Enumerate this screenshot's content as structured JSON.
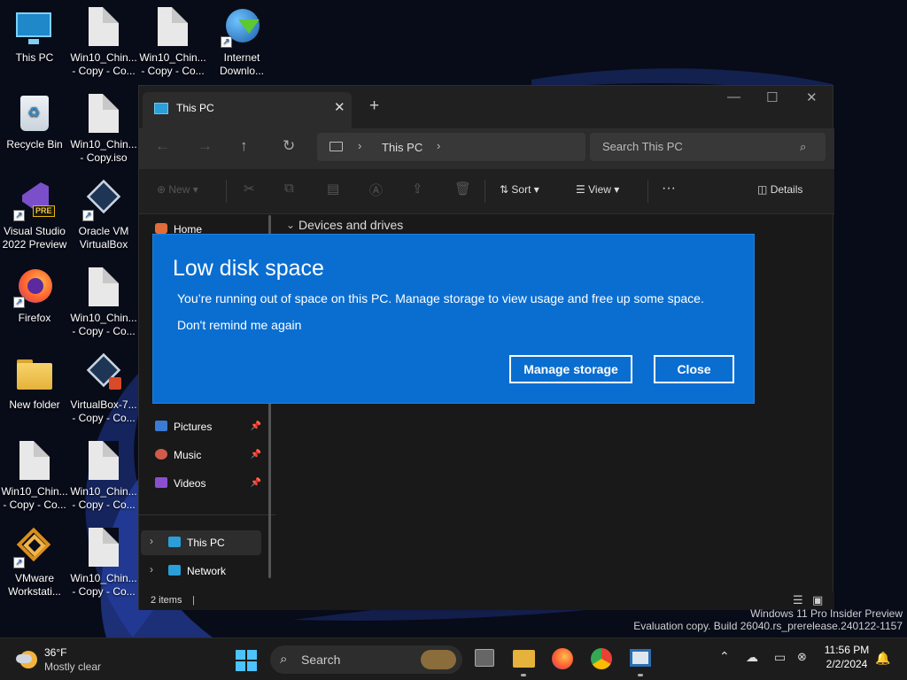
{
  "desktop": {
    "icons": [
      {
        "label": "This PC",
        "icon": "monitor-icon"
      },
      {
        "label": "Win10_Chin... - Copy - Co...",
        "icon": "file-icon"
      },
      {
        "label": "Win10_Chin... - Copy - Co...",
        "icon": "file-icon"
      },
      {
        "label": "Internet Downlo...",
        "icon": "globe-download-icon"
      },
      {
        "label": "Recycle Bin",
        "icon": "recycle-bin-icon"
      },
      {
        "label": "Win10_Chin... - Copy.iso",
        "icon": "file-icon"
      },
      {
        "label": "Visual Studio 2022 Preview",
        "icon": "visual-studio-icon",
        "badge": "PRE"
      },
      {
        "label": "Oracle VM VirtualBox",
        "icon": "virtualbox-icon"
      },
      {
        "label": "Firefox",
        "icon": "firefox-icon"
      },
      {
        "label": "Win10_Chin... - Copy - Co...",
        "icon": "file-icon"
      },
      {
        "label": "New folder",
        "icon": "folder-icon"
      },
      {
        "label": "VirtualBox-7... - Copy - Co...",
        "icon": "virtualbox-icon"
      },
      {
        "label": "Win10_Chin... - Copy - Co...",
        "icon": "file-icon"
      },
      {
        "label": "Win10_Chin... - Copy - Co...",
        "icon": "file-icon"
      },
      {
        "label": "VMware Workstati...",
        "icon": "vmware-icon"
      },
      {
        "label": "Win10_Chin... - Copy - Co...",
        "icon": "file-icon"
      }
    ]
  },
  "explorer": {
    "tab_title": "This PC",
    "new_tab": "+",
    "address": [
      "This PC"
    ],
    "search_placeholder": "Search This PC",
    "toolbar": {
      "new": "New",
      "sort": "Sort",
      "view": "View",
      "more": "···",
      "details": "Details"
    },
    "nav": {
      "home": "Home",
      "pictures": "Pictures",
      "music": "Music",
      "videos": "Videos",
      "this_pc": "This PC",
      "network": "Network"
    },
    "content_header": "Devices and drives",
    "status": "2 items"
  },
  "dialog": {
    "title": "Low disk space",
    "message": "You’re running out of space on this PC. Manage storage to view usage and free up some space.",
    "link": "Don't remind me again",
    "manage_button": "Manage storage",
    "close_button": "Close",
    "accent": "#0a6ed1"
  },
  "watermark": {
    "line1": "Windows 11 Pro Insider Preview",
    "line2": "Evaluation copy. Build 26040.rs_prerelease.240122-1157"
  },
  "taskbar": {
    "weather_temp": "36°F",
    "weather_desc": "Mostly clear",
    "search_label": "Search",
    "time": "11:56 PM",
    "date": "2/2/2024"
  }
}
